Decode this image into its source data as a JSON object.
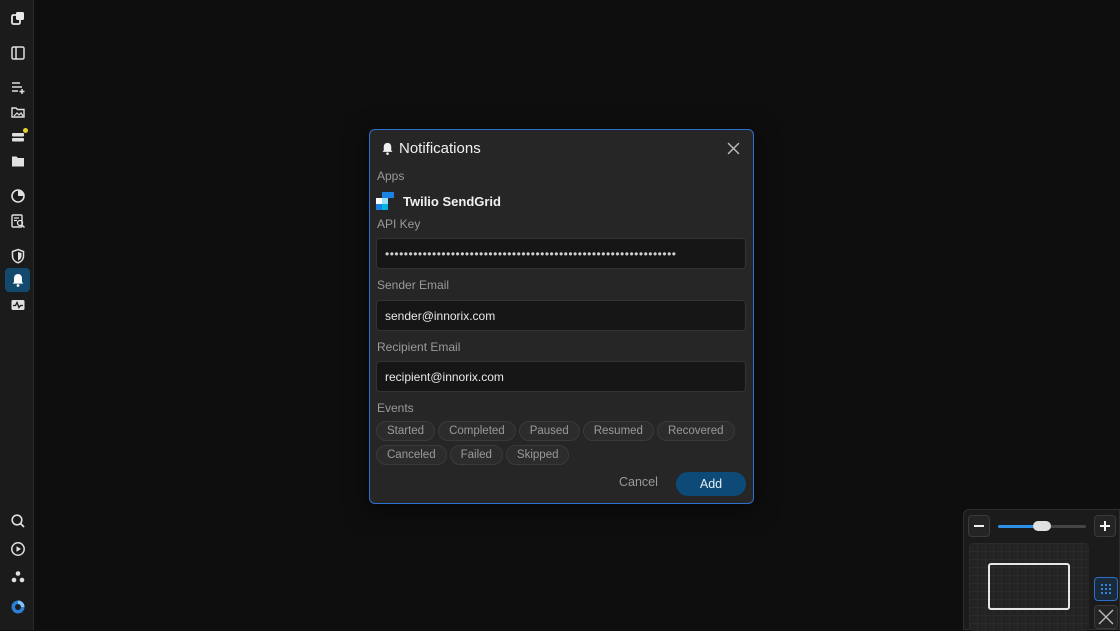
{
  "sidebar": {
    "items": [
      {
        "icon": "logo-icon",
        "name": "sidebar-logo"
      },
      {
        "icon": "panel-toggle-icon",
        "name": "sidebar-item-panel"
      },
      {
        "icon": "list-add-icon",
        "name": "sidebar-item-flows"
      },
      {
        "icon": "image-folder-icon",
        "name": "sidebar-item-assets"
      },
      {
        "icon": "server-icon",
        "name": "sidebar-item-servers",
        "badge_color": "#e6d22a"
      },
      {
        "icon": "folder-icon",
        "name": "sidebar-item-files"
      },
      {
        "icon": "pie-chart-icon",
        "name": "sidebar-item-analytics"
      },
      {
        "icon": "report-search-icon",
        "name": "sidebar-item-reports"
      },
      {
        "icon": "shield-icon",
        "name": "sidebar-item-security"
      },
      {
        "icon": "bell-icon",
        "name": "sidebar-item-notifications",
        "active": true
      },
      {
        "icon": "pulse-icon",
        "name": "sidebar-item-monitoring"
      },
      {
        "icon": "search-icon",
        "name": "sidebar-item-search"
      },
      {
        "icon": "play-circle-icon",
        "name": "sidebar-item-run"
      },
      {
        "icon": "community-icon",
        "name": "sidebar-item-community"
      },
      {
        "icon": "account-icon",
        "name": "sidebar-item-account"
      }
    ],
    "active_color": "#13496d"
  },
  "modal": {
    "title": "Notifications",
    "apps_label": "Apps",
    "app_name": "Twilio SendGrid",
    "api_key_label": "API Key",
    "api_key_value": "••••••••••••••••••••••••••••••••••••••••••••••••••••••••••••••",
    "sender_label": "Sender Email",
    "sender_value": "sender@innorix.com",
    "recipient_label": "Recipient Email",
    "recipient_value": "recipient@innorix.com",
    "events_label": "Events",
    "events_row1": [
      "Started",
      "Completed",
      "Paused",
      "Resumed",
      "Recovered"
    ],
    "events_row2": [
      "Canceled",
      "Failed",
      "Skipped"
    ],
    "cancel_label": "Cancel",
    "add_label": "Add",
    "border_color": "#2f6fd0",
    "add_color": "#0d4a78"
  },
  "zoom": {
    "level_fraction": 0.5,
    "accent": "#2d8fe6"
  }
}
